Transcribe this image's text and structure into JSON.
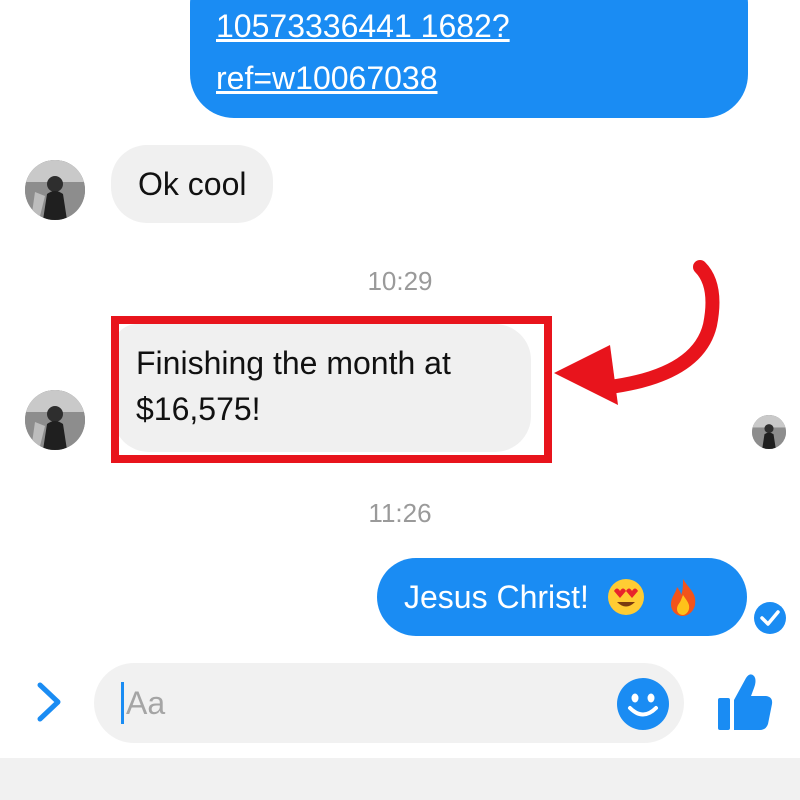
{
  "messages": {
    "link": {
      "line1": "10573336441 1682?",
      "line2": "ref=w10067038"
    },
    "incoming_1": "Ok cool",
    "timestamp_1": "10:29",
    "incoming_2": "Finishing the month at $16,575!",
    "timestamp_2": "11:26",
    "outgoing": "Jesus Christ!",
    "outgoing_emojis": [
      "heart-eyes-emoji",
      "fire-emoji"
    ]
  },
  "composer": {
    "placeholder": "Aa"
  },
  "colors": {
    "accent": "#1a8cf3",
    "incoming_bubble": "#f0f0f0",
    "highlight": "#e8141c",
    "timestamp": "#9a9a9a"
  },
  "icons": {
    "expand": "chevron-right-icon",
    "emoji": "smiley-icon",
    "like": "thumbs-up-icon",
    "seen": "seen-check-icon"
  }
}
